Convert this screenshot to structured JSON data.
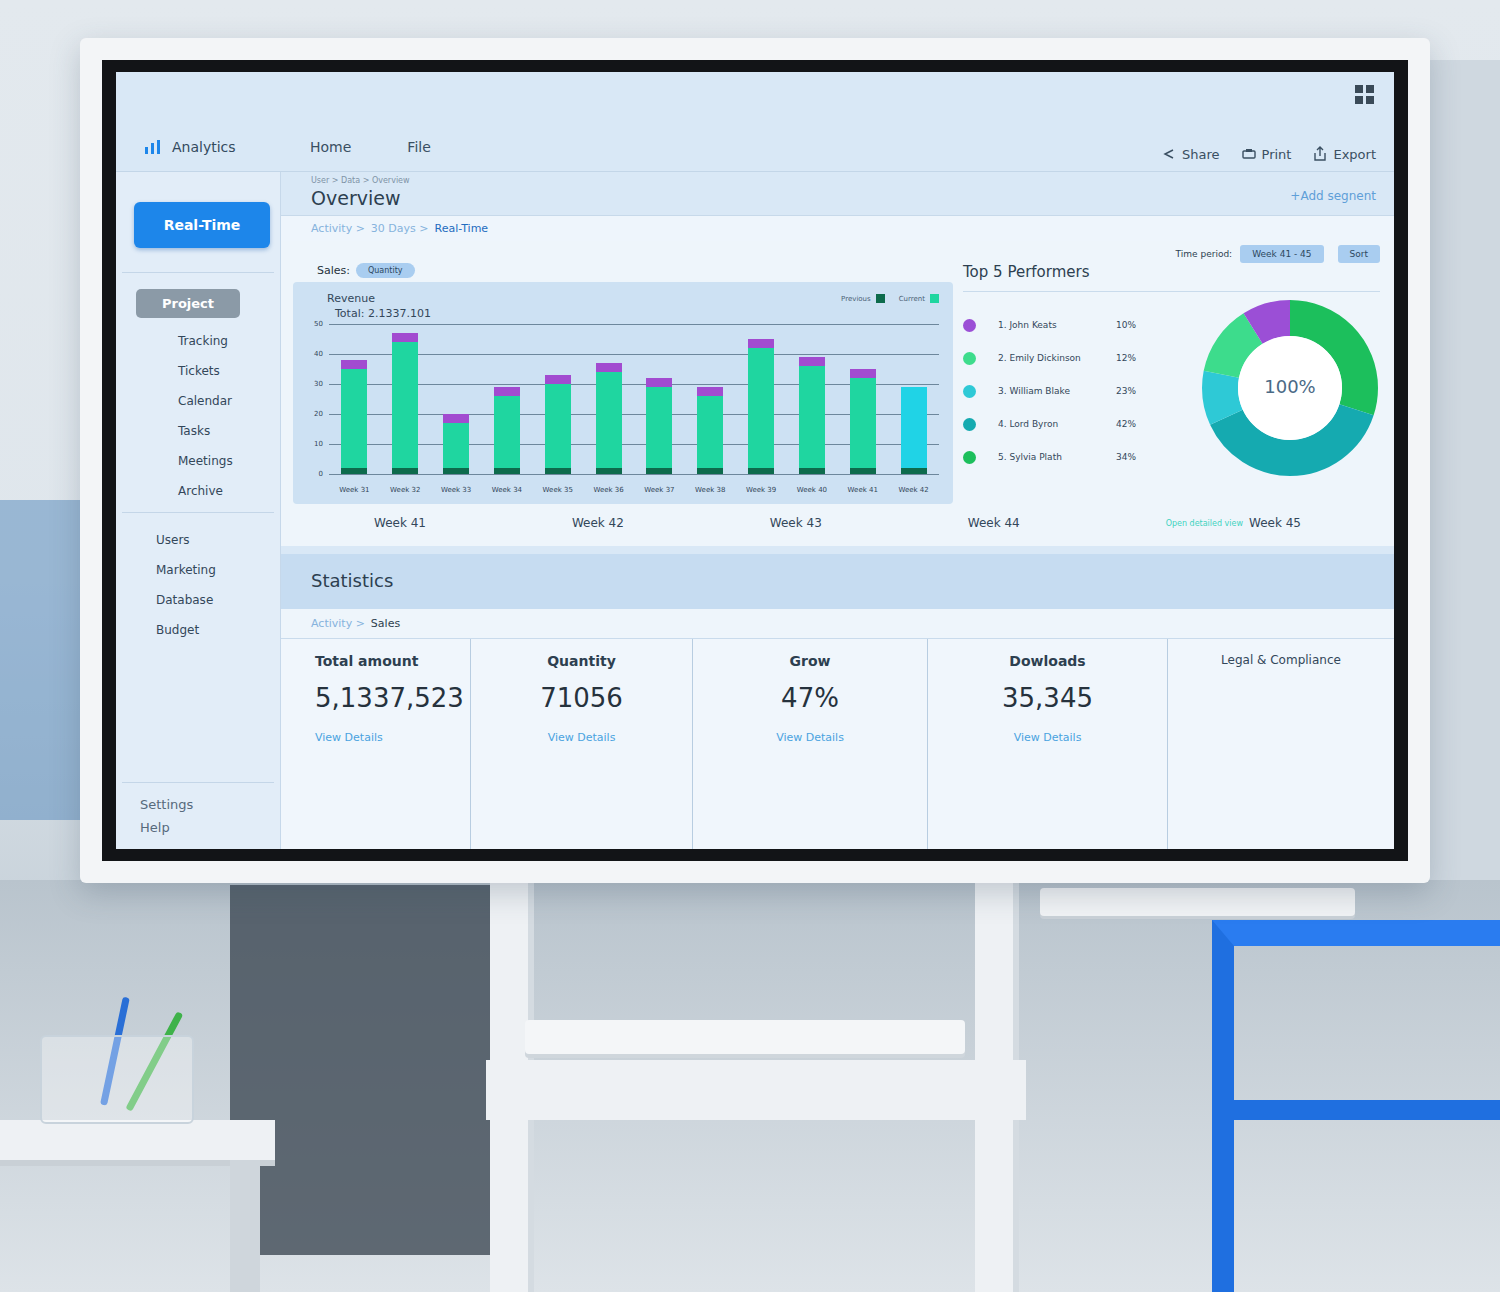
{
  "header": {
    "logo": "Analytics",
    "menu": [
      {
        "label": "Home"
      },
      {
        "label": "File"
      }
    ],
    "actions": [
      {
        "label": "Share"
      },
      {
        "label": "Print"
      },
      {
        "label": "Export"
      }
    ]
  },
  "sidebar": {
    "realtime": "Real-Time",
    "project": {
      "label": "Project",
      "selected": true
    },
    "project_items": [
      "Tracking",
      "Tickets",
      "Calendar",
      "Tasks",
      "Meetings",
      "Archive"
    ],
    "items": [
      "Users",
      "Marketing",
      "Database",
      "Budget"
    ],
    "footer": [
      "Settings",
      "Help"
    ]
  },
  "overview": {
    "breadcrumb": "User > Data > Overview",
    "title": "Overview",
    "add_segment": "+Add segnent",
    "crumbs": [
      {
        "label": "Activity >",
        "selected": false
      },
      {
        "label": "30 Days >",
        "selected": false
      },
      {
        "label": "Real-Time",
        "selected": true
      }
    ],
    "time_period_label": "Time period:",
    "time_period": "Week 41 - 45",
    "sort": "Sort",
    "sales_label": "Sales:",
    "sales_chip": "Quantity"
  },
  "chart": {
    "title": "Revenue",
    "total": "Total: 2.1337.101",
    "y_ticks": [
      "50",
      "40",
      "30",
      "20",
      "10",
      "0"
    ],
    "x_labels": [
      "Week 31",
      "Week 32",
      "Week 33",
      "Week 34",
      "Week 35",
      "Week 36",
      "Week 37",
      "Week 38",
      "Week 39",
      "Week 40",
      "Week 41",
      "Week 42"
    ],
    "highlight": [
      false,
      false,
      false,
      false,
      false,
      false,
      false,
      false,
      false,
      false,
      false,
      true
    ],
    "series": [
      {
        "label": "Previous",
        "color": "#0d6b4c",
        "values": [
          2,
          2,
          2,
          2,
          2,
          2,
          2,
          2,
          2,
          2,
          2,
          2
        ]
      },
      {
        "label": "Current",
        "color": "#1fd6a0",
        "values": [
          33,
          42,
          15,
          24,
          28,
          32,
          27,
          24,
          40,
          34,
          30,
          27
        ]
      },
      {
        "color": "#a24bd0",
        "values": [
          3,
          3,
          3,
          3,
          3,
          3,
          3,
          3,
          3,
          3,
          3,
          0
        ]
      }
    ]
  },
  "performers": {
    "title": "Top 5 Performers",
    "center": "100%",
    "items": [
      {
        "name": "1. John Keats",
        "percent": "10%",
        "color": "#9b4fd6",
        "share": 0.09
      },
      {
        "name": "2. Emily Dickinson",
        "percent": "12%",
        "color": "#3ddc8c",
        "share": 0.13
      },
      {
        "name": "3. William Blake",
        "percent": "23%",
        "color": "#2ec9d6",
        "share": 0.1
      },
      {
        "name": "4. Lord Byron",
        "percent": "42%",
        "color": "#15aab0",
        "share": 0.38
      },
      {
        "name": "5. Sylvia Plath",
        "percent": "34%",
        "color": "#1cbf5c",
        "share": 0.3
      }
    ]
  },
  "week_axis": {
    "weeks": [
      "Week 41",
      "Week 42",
      "Week 43",
      "Week 44",
      "Week 45"
    ],
    "link": "Open detailed view"
  },
  "statistics": {
    "title": "Statistics",
    "crumbs": [
      {
        "label": "Activity >",
        "selected": false
      },
      {
        "label": "Sales",
        "selected": true
      }
    ],
    "cards": [
      {
        "title": "Total amount",
        "value": "5,1337,523",
        "link": "View Details"
      },
      {
        "title": "Quantity",
        "value": "71056",
        "link": "View Details"
      },
      {
        "title": "Grow",
        "value": "47%",
        "link": "View Details"
      },
      {
        "title": "Dowloads",
        "value": "35,345",
        "link": "View Details"
      }
    ],
    "extra": "Legal & Compliance"
  }
}
